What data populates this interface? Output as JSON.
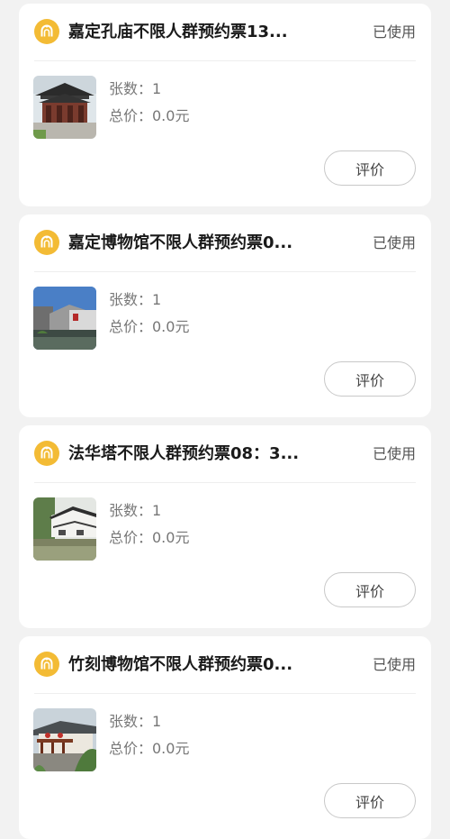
{
  "orders": [
    {
      "title": "嘉定孔庙不限人群预约票13...",
      "status": "已使用",
      "quantity": "张数：1",
      "total": "总价：0.0元",
      "review_label": "评价",
      "thumb": "temple-photo"
    },
    {
      "title": "嘉定博物馆不限人群预约票0...",
      "status": "已使用",
      "quantity": "张数：1",
      "total": "总价：0.0元",
      "review_label": "评价",
      "thumb": "museum-photo"
    },
    {
      "title": "法华塔不限人群预约票08：3...",
      "status": "已使用",
      "quantity": "张数：1",
      "total": "总价：0.0元",
      "review_label": "评价",
      "thumb": "canal-houses-photo"
    },
    {
      "title": "竹刻博物馆不限人群预约票0...",
      "status": "已使用",
      "quantity": "张数：1",
      "total": "总价：0.0元",
      "review_label": "评价",
      "thumb": "courtyard-photo"
    }
  ],
  "colors": {
    "accent": "#f3bb35",
    "page_bg": "#f2f2f2",
    "card_bg": "#ffffff"
  }
}
